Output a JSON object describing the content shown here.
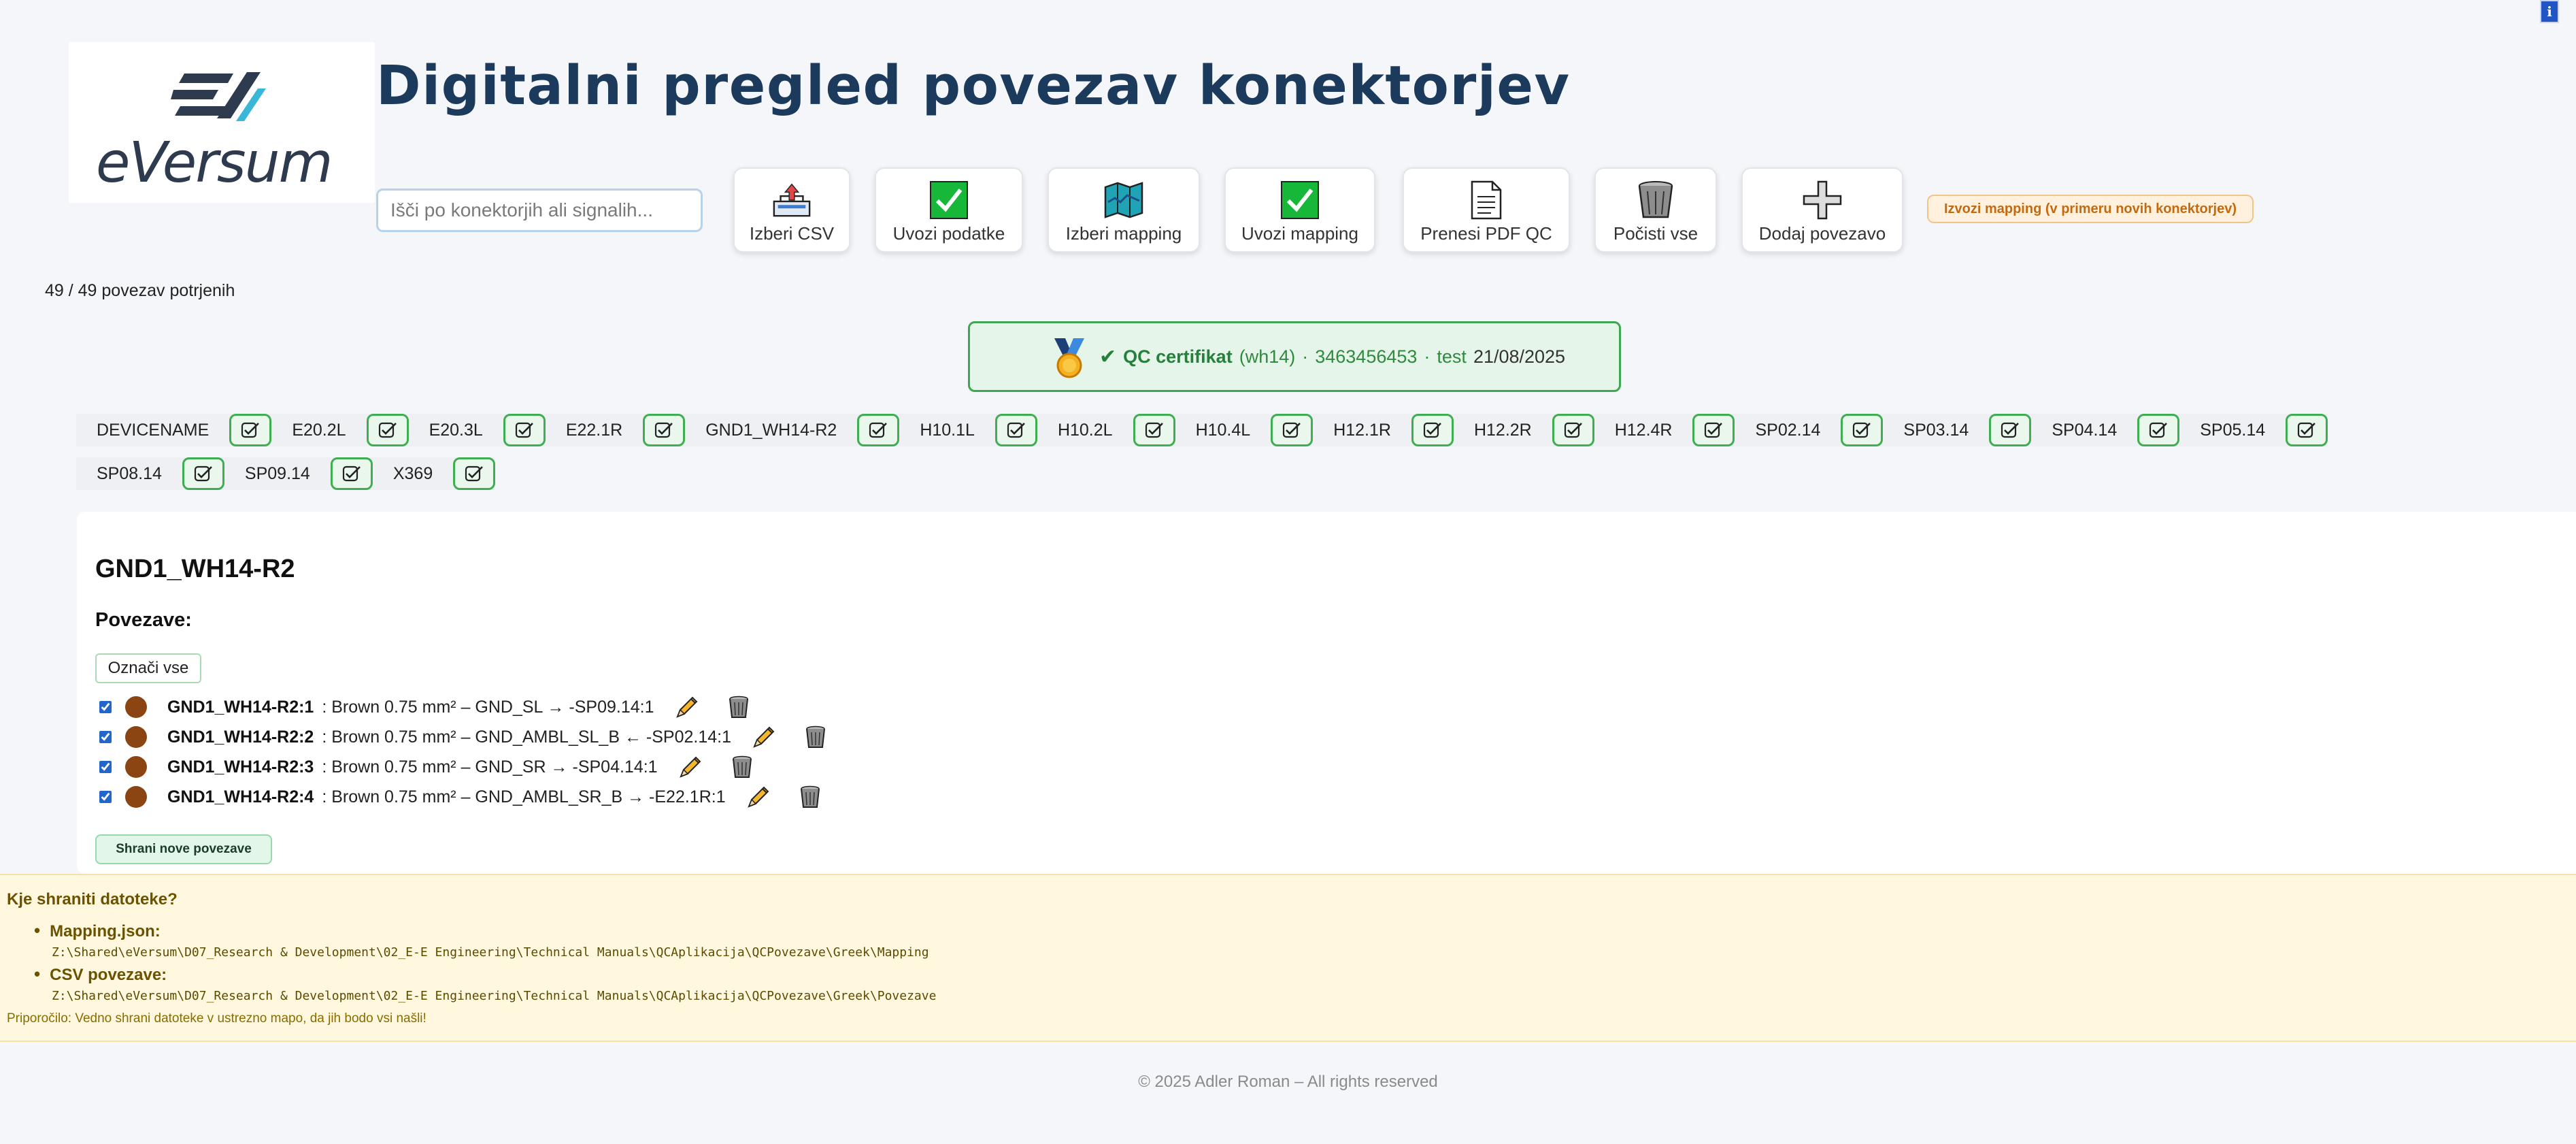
{
  "header": {
    "title": "Digitalni pregled povezav konektorjev",
    "logo_text": "eVersum",
    "info_corner": "i"
  },
  "search": {
    "placeholder": "Išči po konektorjih ali signalih..."
  },
  "toolbar": {
    "buttons": [
      {
        "label": "Izberi CSV",
        "icon": "tray-upload-icon"
      },
      {
        "label": "Uvozi podatke",
        "icon": "check-icon"
      },
      {
        "label": "Izberi mapping",
        "icon": "map-icon"
      },
      {
        "label": "Uvozi mapping",
        "icon": "check-icon"
      },
      {
        "label": "Prenesi PDF QC",
        "icon": "document-icon"
      },
      {
        "label": "Počisti vse",
        "icon": "trash-icon"
      },
      {
        "label": "Dodaj povezavo",
        "icon": "plus-icon"
      }
    ],
    "export_label": "Izvozi mapping (v primeru novih konektorjev)"
  },
  "status": {
    "confirmed": "49 / 49 povezav potrjenih"
  },
  "qc": {
    "check": "✔",
    "label": "QC certifikat",
    "project": "(wh14)",
    "sep1": "·",
    "id": "3463456453",
    "sep2": "·",
    "user": "test",
    "date": "21/08/2025"
  },
  "connectors": {
    "row1": [
      "DEVICENAME",
      "E20.2L",
      "E20.3L",
      "E22.1R",
      "GND1_WH14-R2",
      "H10.1L",
      "H10.2L",
      "H10.4L",
      "H12.1R",
      "H12.2R",
      "H12.4R",
      "SP02.14",
      "SP03.14",
      "SP04.14",
      "SP05.14"
    ],
    "row2": [
      "SP08.14",
      "SP09.14",
      "X369"
    ]
  },
  "detail": {
    "title": "GND1_WH14-R2",
    "subtitle": "Povezave:",
    "mark_all": "Označi vse",
    "connections": [
      {
        "name": "GND1_WH14-R2:1",
        "desc": ": Brown 0.75 mm² – GND_SL → -SP09.14:1",
        "color": "#8b4513",
        "checked": true
      },
      {
        "name": "GND1_WH14-R2:2",
        "desc": ": Brown 0.75 mm² – GND_AMBL_SL_B ← -SP02.14:1",
        "color": "#8b4513",
        "checked": true
      },
      {
        "name": "GND1_WH14-R2:3",
        "desc": ": Brown 0.75 mm² – GND_SR → -SP04.14:1",
        "color": "#8b4513",
        "checked": true
      },
      {
        "name": "GND1_WH14-R2:4",
        "desc": ": Brown 0.75 mm² – GND_AMBL_SR_B → -E22.1R:1",
        "color": "#8b4513",
        "checked": true
      }
    ],
    "save_label": "Shrani nove povezave"
  },
  "save_info": {
    "title": "Kje shraniti datoteke?",
    "mapping_label": "Mapping.json:",
    "mapping_path": "Z:\\Shared\\eVersum\\D07_Research & Development\\02_E-E Engineering\\Technical Manuals\\QCAplikacija\\QCPovezave\\Greek\\Mapping",
    "csv_label": "CSV povezave:",
    "csv_path": "Z:\\Shared\\eVersum\\D07_Research & Development\\02_E-E Engineering\\Technical Manuals\\QCAplikacija\\QCPovezave\\Greek\\Povezave",
    "tip": "Priporočilo: Vedno shrani datoteke v ustrezno mapo, da jih bodo vsi našli!"
  },
  "footer": {
    "text": "© 2025 Adler Roman – All rights reserved"
  }
}
